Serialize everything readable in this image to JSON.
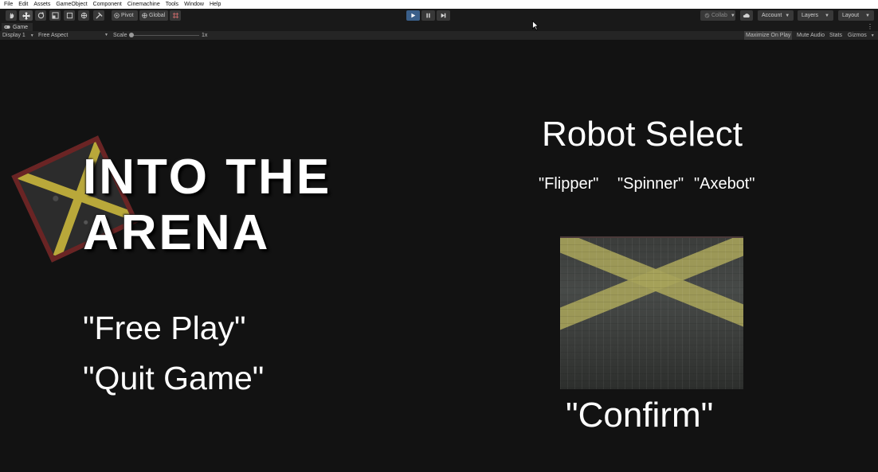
{
  "menu": [
    "File",
    "Edit",
    "Assets",
    "GameObject",
    "Component",
    "Cinemachine",
    "Tools",
    "Window",
    "Help"
  ],
  "toolbar": {
    "pivot_label": "Pivot",
    "global_label": "Global",
    "collab_label": "Collab",
    "account_label": "Account",
    "layers_label": "Layers",
    "layout_label": "Layout"
  },
  "tab": {
    "label": "Game"
  },
  "game_options": {
    "display": "Display 1",
    "aspect": "Free Aspect",
    "scale_label": "Scale",
    "scale_value": "1x",
    "maximize": "Maximize On Play",
    "mute": "Mute Audio",
    "stats": "Stats",
    "gizmos": "Gizmos"
  },
  "game": {
    "title_line1": "INTO THE",
    "title_line2": "ARENA",
    "free_play": "\"Free Play\"",
    "quit_game": "\"Quit Game\"",
    "robot_select": "Robot Select",
    "robots": [
      "\"Flipper\"",
      "\"Spinner\"",
      "\"Axebot\""
    ],
    "confirm": "\"Confirm\""
  },
  "colors": {
    "accent_play": "#3a5f8a",
    "tile_border": "#6a2424",
    "stripe_yellow": "#b9a83a"
  }
}
